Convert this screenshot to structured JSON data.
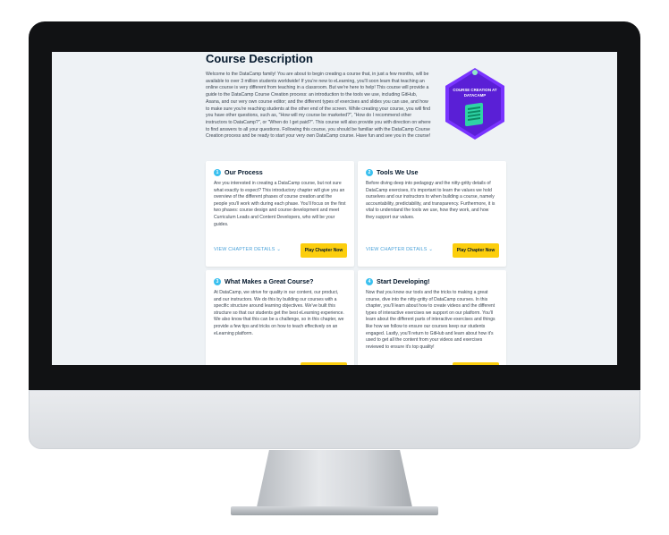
{
  "page": {
    "title": "Course Description",
    "intro": "Welcome to the DataCamp family! You are about to begin creating a course that, in just a few months, will be available to over 3 million students worldwide! If you're new to eLearning, you'll soon learn that teaching an online course is very different from teaching in a classroom. But we're here to help! This course will provide a guide to the DataCamp Course Creation process: an introduction to the tools we use, including GitHub, Asana, and our very own course editor; and the different types of exercises and slides you can use, and how to make sure you're reaching students at the other end of the screen. While creating your course, you will find you have other questions, such as, \"How will my course be marketed?\", \"How do I recommend other instructors to DataCamp?\", or \"When do I get paid?\". This course will also provide you with direction on where to find answers to all your questions. Following this course, you should be familiar with the DataCamp Course Creation process and be ready to start your very own DataCamp course. Have fun and see you in the course!"
  },
  "badge": {
    "text": "COURSE CREATION AT DATACAMP"
  },
  "chapters": [
    {
      "number": "1",
      "title": "Our Process",
      "body": "Are you interested in creating a DataCamp course, but not sure what exactly to expect? This introductory chapter will give you an overview of the different phases of course creation and the people you'll work with during each phase. You'll focus on the first two phases: course design and course development and meet Curriculum Leads and Content Developers, who will be your guides.",
      "link": "VIEW CHAPTER DETAILS",
      "button": "Play Chapter Now"
    },
    {
      "number": "2",
      "title": "Tools We Use",
      "body": "Before diving deep into pedagogy and the nitty-gritty details of DataCamp exercises, it's important to learn the values we hold ourselves and our instructors to when building a course, namely accountability, predictability, and transparency. Furthermore, it is vital to understand the tools we use, how they work, and how they support our values.",
      "link": "VIEW CHAPTER DETAILS",
      "button": "Play Chapter Now"
    },
    {
      "number": "3",
      "title": "What Makes a Great Course?",
      "body": "At DataCamp, we strive for quality in our content, our product, and our instructors. We do this by building our courses with a specific structure around learning objectives. We've built this structure so that our students get the best eLearning experience. We also know that this can be a challenge, so in this chapter, we provide a few tips and tricks on how to teach effectively on an eLearning platform.",
      "link": "",
      "button": ""
    },
    {
      "number": "4",
      "title": "Start Developing!",
      "body": "Now that you know our tools and the tricks to making a great course, dive into the nitty-gritty of DataCamp courses. In this chapter, you'll learn about how to create videos and the different types of interactive exercises we support on our platform. You'll learn about the different parts of interactive exercises and things like how we follow to ensure our courses keep our students engaged. Lastly, you'll return to GitHub and learn about how it's used to get all the content from your videos and exercises reviewed to ensure it's top quality!",
      "link": "",
      "button": ""
    }
  ],
  "colors": {
    "accent": "#3ac0ef",
    "button": "#fcce0d",
    "badge": "#7933ff",
    "link": "#4aa2d9"
  }
}
